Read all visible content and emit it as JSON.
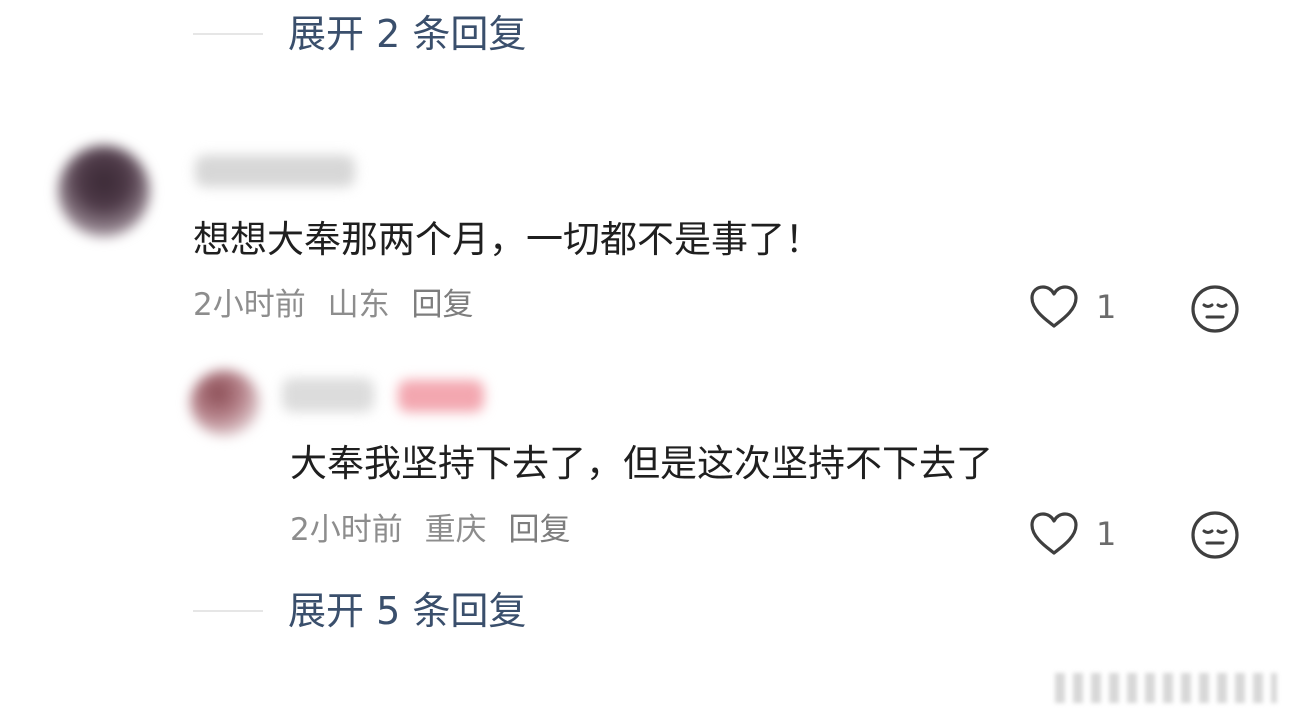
{
  "expand_top": {
    "label": "展开 2 条回复"
  },
  "comment": {
    "text": "想想大奉那两个月，一切都不是事了！",
    "meta": {
      "time": "2小时前",
      "location": "山东",
      "reply": "回复"
    },
    "likes": "1"
  },
  "reply": {
    "text": "大奉我坚持下去了，但是这次坚持不下去了",
    "meta": {
      "time": "2小时前",
      "location": "重庆",
      "reply": "回复"
    },
    "likes": "1"
  },
  "expand_bottom": {
    "label": "展开 5 条回复"
  },
  "colors": {
    "link": "#3a4f6c",
    "text": "#1f1f1f",
    "meta": "#8d8d8d"
  },
  "icons": [
    "heart-outline-icon",
    "neutral-face-icon"
  ]
}
